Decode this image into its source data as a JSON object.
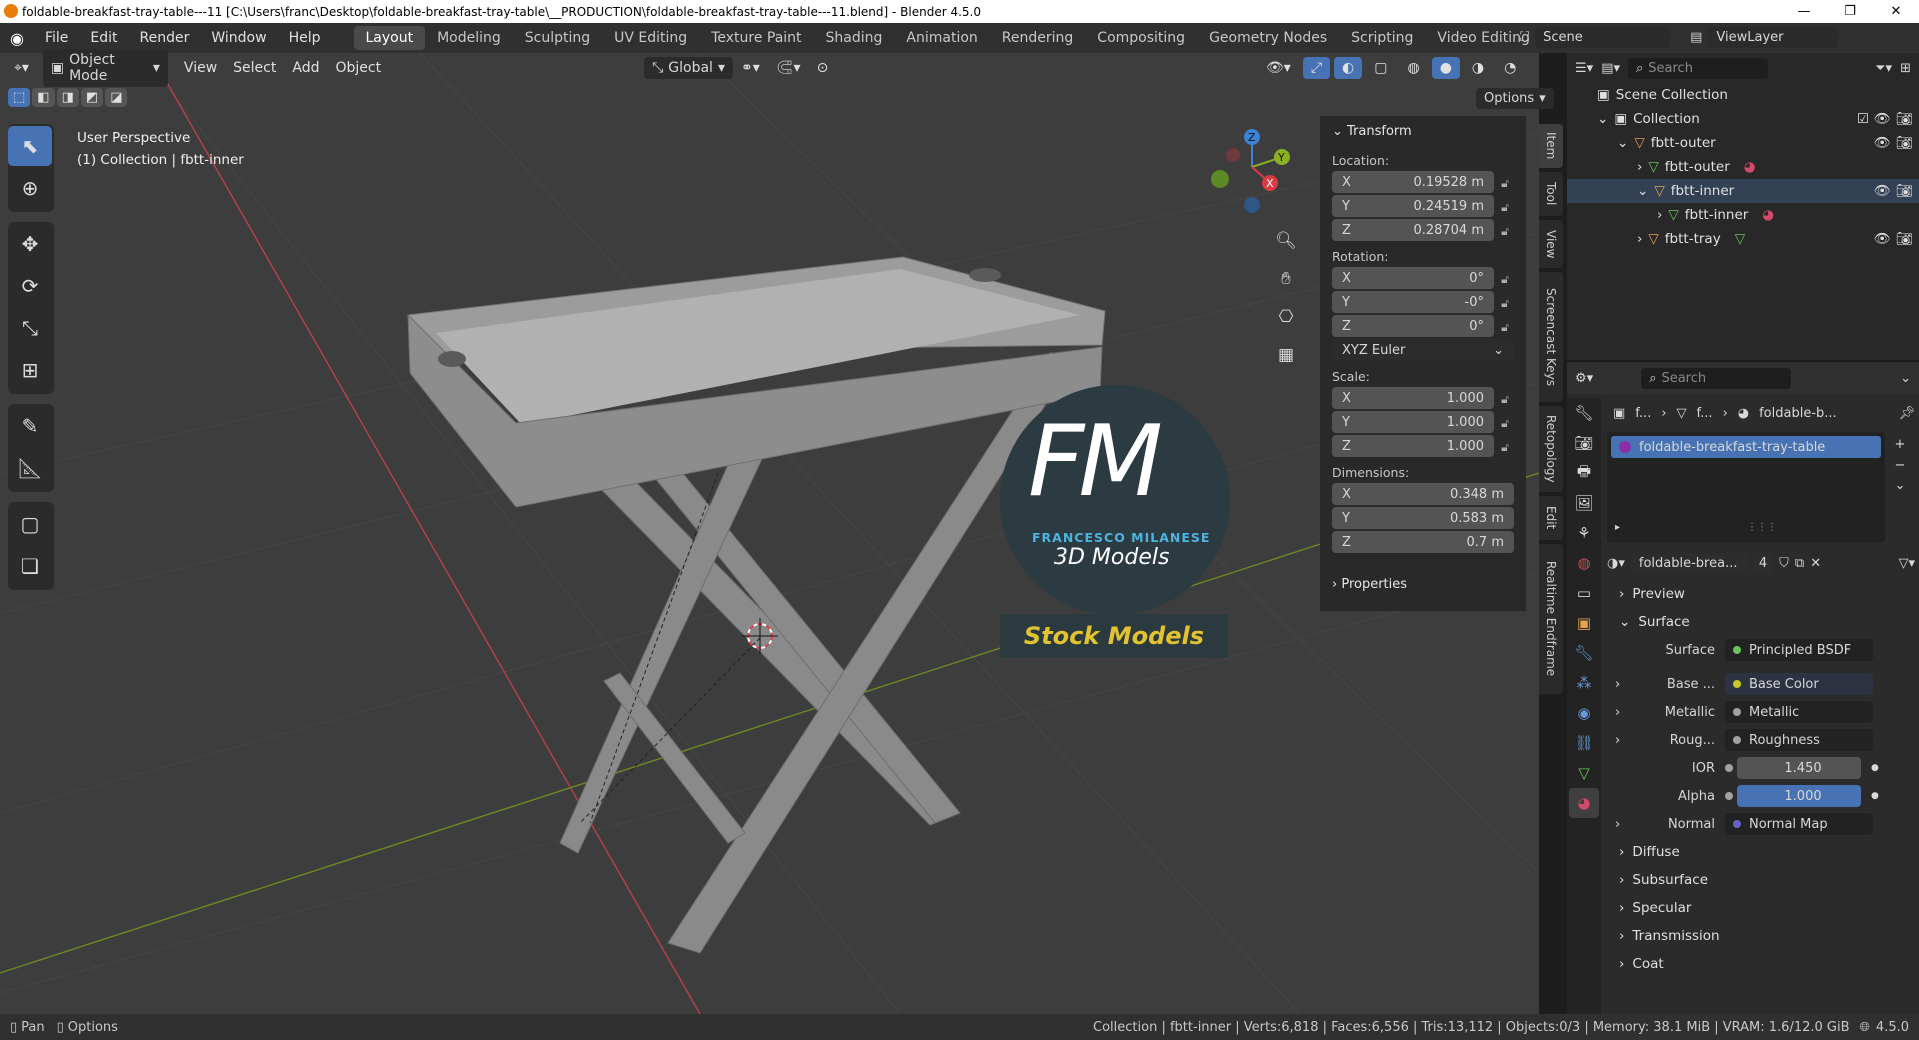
{
  "title": {
    "text": "foldable-breakfast-tray-table---11 [C:\\Users\\franc\\Desktop\\foldable-breakfast-tray-table\\__PRODUCTION\\foldable-breakfast-tray-table---11.blend] - Blender 4.5.0",
    "min": "—",
    "max": "❐",
    "close": "✕"
  },
  "menus": [
    "File",
    "Edit",
    "Render",
    "Window",
    "Help"
  ],
  "workspaces": [
    "Layout",
    "Modeling",
    "Sculpting",
    "UV Editing",
    "Texture Paint",
    "Shading",
    "Animation",
    "Rendering",
    "Compositing",
    "Geometry Nodes",
    "Scripting",
    "Video Editing"
  ],
  "active_workspace": "Layout",
  "scene": {
    "label": "Scene",
    "viewlayer": "ViewLayer"
  },
  "viewport_header": {
    "mode": "Object Mode",
    "menu": [
      "View",
      "Select",
      "Add",
      "Object"
    ],
    "orientation": "Global",
    "options": "Options"
  },
  "overlay_text": {
    "perspective": "User Perspective",
    "collection": "(1) Collection | fbtt-inner"
  },
  "gizmo": {
    "x": "X",
    "y": "Y",
    "z": "Z"
  },
  "watermark": {
    "big": "FM",
    "name": "FRANCESCO MILANESE",
    "sub": "3D Models",
    "banner": "Stock Models"
  },
  "npanel": {
    "section": "Transform",
    "location_label": "Location:",
    "location": [
      {
        "axis": "X",
        "value": "0.19528 m"
      },
      {
        "axis": "Y",
        "value": "0.24519 m"
      },
      {
        "axis": "Z",
        "value": "0.28704 m"
      }
    ],
    "rotation_label": "Rotation:",
    "rotation": [
      {
        "axis": "X",
        "value": "0°"
      },
      {
        "axis": "Y",
        "value": "-0°"
      },
      {
        "axis": "Z",
        "value": "0°"
      }
    ],
    "rotation_mode": "XYZ Euler",
    "scale_label": "Scale:",
    "scale": [
      {
        "axis": "X",
        "value": "1.000"
      },
      {
        "axis": "Y",
        "value": "1.000"
      },
      {
        "axis": "Z",
        "value": "1.000"
      }
    ],
    "dimensions_label": "Dimensions:",
    "dimensions": [
      {
        "axis": "X",
        "value": "0.348 m"
      },
      {
        "axis": "Y",
        "value": "0.583 m"
      },
      {
        "axis": "Z",
        "value": "0.7 m"
      }
    ],
    "properties": "Properties"
  },
  "side_tabs": [
    "Item",
    "Tool",
    "View",
    "Screencast Keys",
    "Retopology",
    "Edit",
    "Realtime Endframe"
  ],
  "outliner": {
    "search_placeholder": "Search",
    "rows": [
      {
        "label": "Scene Collection"
      },
      {
        "label": "Collection"
      },
      {
        "label": "fbtt-outer"
      },
      {
        "label": "fbtt-outer"
      },
      {
        "label": "fbtt-inner"
      },
      {
        "label": "fbtt-inner"
      },
      {
        "label": "fbtt-tray"
      }
    ]
  },
  "properties_editor": {
    "search_placeholder": "Search",
    "breadcrumb": [
      "f...",
      "f...",
      "foldable-b..."
    ],
    "material_slot": "foldable-breakfast-tray-table",
    "material_name": "foldable-brea...",
    "users": "4",
    "sections": {
      "preview": "Preview",
      "surface": "Surface"
    },
    "rows": [
      {
        "label": "Surface",
        "value": "Principled BSDF",
        "dot": "#6ac45c"
      },
      {
        "label": "Base ...",
        "value": "Base Color",
        "dot": "#c7c729"
      },
      {
        "label": "Metallic",
        "value": "Metallic",
        "dot": "#a1a1a1"
      },
      {
        "label": "Roug...",
        "value": "Roughness",
        "dot": "#a1a1a1"
      },
      {
        "label": "IOR",
        "value": "1.450",
        "dot": "#a1a1a1"
      },
      {
        "label": "Alpha",
        "value": "1.000",
        "dot": "#a1a1a1"
      },
      {
        "label": "Normal",
        "value": "Normal Map",
        "dot": "#6363c7"
      }
    ],
    "subsections": [
      "Diffuse",
      "Subsurface",
      "Specular",
      "Transmission",
      "Coat"
    ]
  },
  "status": {
    "pan": "Pan",
    "options": "Options",
    "stats": "Collection | fbtt-inner | Verts:6,818 | Faces:6,556 | Tris:13,112 | Objects:0/3 | Memory: 38.1 MiB | VRAM: 1.6/12.0 GiB",
    "version": "4.5.0"
  },
  "colors": {
    "accent": "#4772b3",
    "viewport_bg": "#3d3d3d",
    "panel_bg": "#282828",
    "x_axis": "#d83b43",
    "y_axis": "#8bb022",
    "z_axis": "#3c82d6"
  }
}
